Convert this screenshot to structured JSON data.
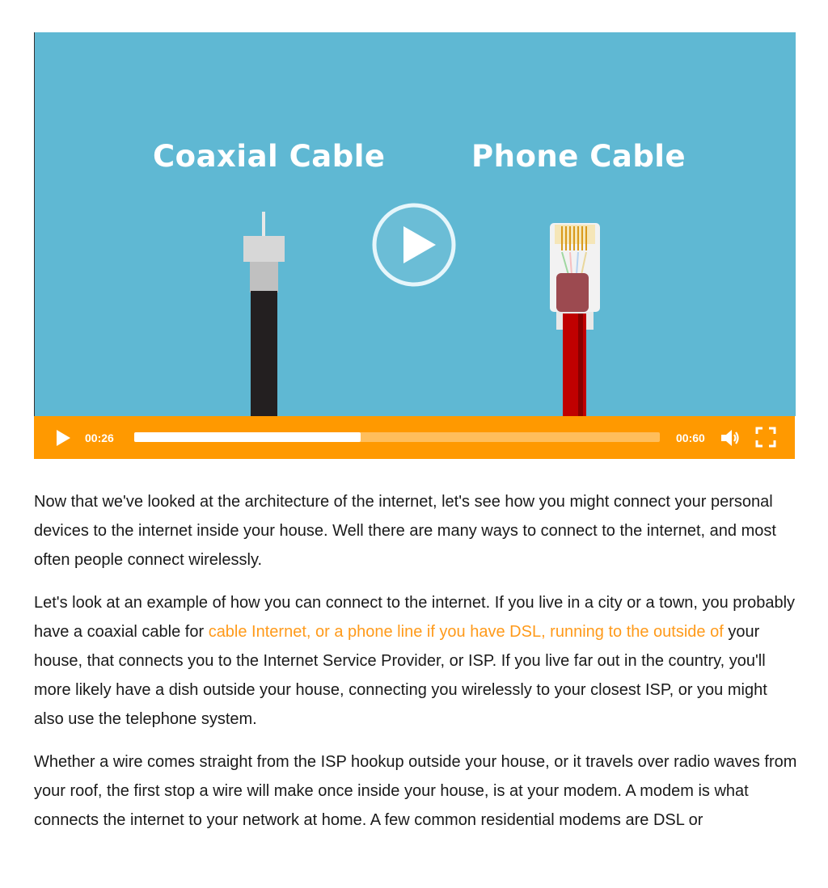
{
  "video": {
    "left_label": "Coaxial Cable",
    "right_label": "Phone Cable",
    "current_time": "00:26",
    "total_time": "00:60",
    "progress_fraction": 0.43,
    "accent_color": "#ff9900",
    "background_color": "#5fb8d3",
    "icons": {
      "big_play": "play-circle-icon",
      "play": "play-icon",
      "volume": "volume-icon",
      "fullscreen": "fullscreen-icon"
    }
  },
  "article": {
    "p1": "Now that we've looked at the architecture of the internet, let's see how you might connect your personal devices to the internet inside your house. Well there are many ways to connect to the internet, and most often people connect wirelessly.",
    "p2_before": "Let's look at an example of how you can connect to the internet. If you live in a city or a town, you probably have a coaxial cable for ",
    "p2_highlight": "cable Internet, or a phone line if you have DSL, running to the outside of",
    "p2_after": " your house, that connects you to the Internet Service Provider, or ISP. If you live far out in the country, you'll more likely have a dish outside your house, connecting you wirelessly to your closest ISP, or you might also use the telephone system.",
    "p3": "Whether a wire comes straight from the ISP hookup outside your house, or it travels over radio waves from your roof, the first stop a wire will make once inside your house, is at your modem. A modem is what connects the internet to your network at home. A few common residential modems are DSL or",
    "highlight_color": "#ff9a1a"
  }
}
